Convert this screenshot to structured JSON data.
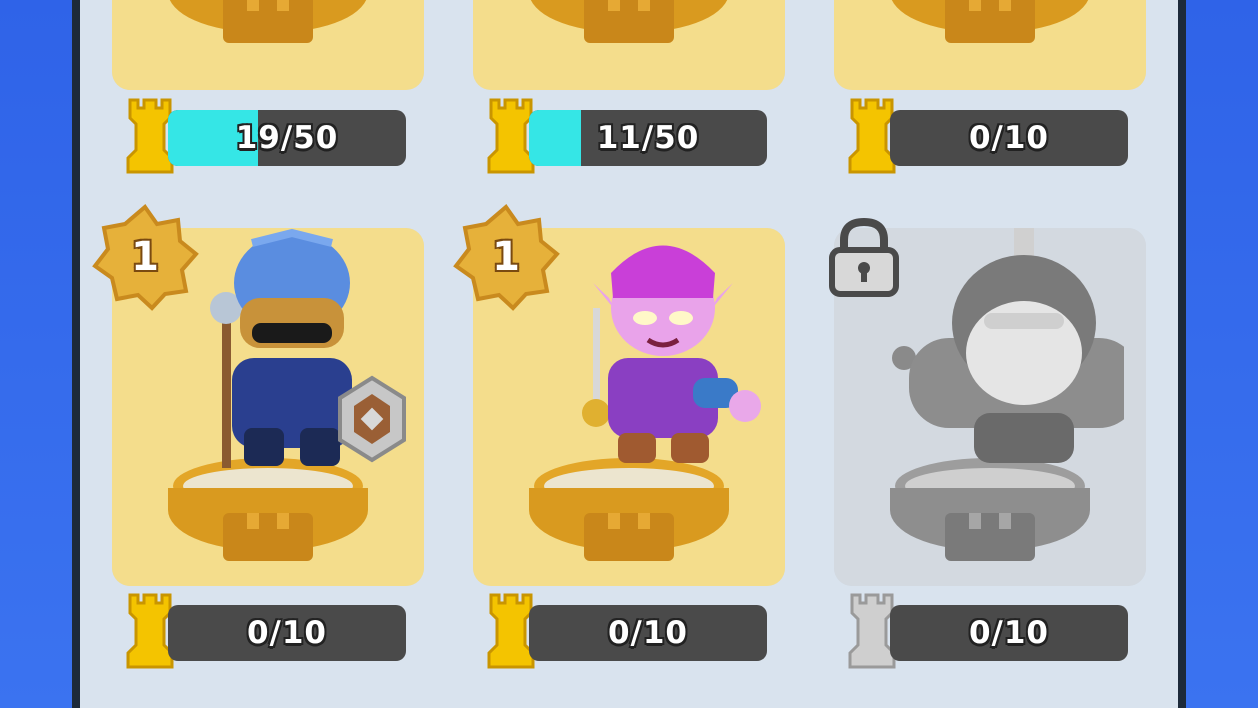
{
  "top_row": [
    {
      "progress_label": "19/50",
      "progress": 0.38,
      "locked": false
    },
    {
      "progress_label": "11/50",
      "progress": 0.22,
      "locked": false
    },
    {
      "progress_label": "0/10",
      "progress": 0.0,
      "locked": false
    }
  ],
  "bottom_row": [
    {
      "character": "blue-helmet-knight-statue",
      "level": "1",
      "progress_label": "0/10",
      "progress": 0.0,
      "locked": false
    },
    {
      "character": "pink-goblin-fencer-statue",
      "level": "1",
      "progress_label": "0/10",
      "progress": 0.0,
      "locked": false
    },
    {
      "character": "bearded-warrior-statue",
      "progress_label": "0/10",
      "progress": 0.0,
      "locked": true
    }
  ],
  "colors": {
    "background": "#2f63e8",
    "panel": "#d9e3ee",
    "card_gold": "#f4dd8c",
    "card_locked": "#d3d9e0",
    "progress_fill": "#35e6e6",
    "progress_track": "#4a4a4a",
    "rook_gold": "#f4c400",
    "rook_locked": "#c8c8c8"
  }
}
